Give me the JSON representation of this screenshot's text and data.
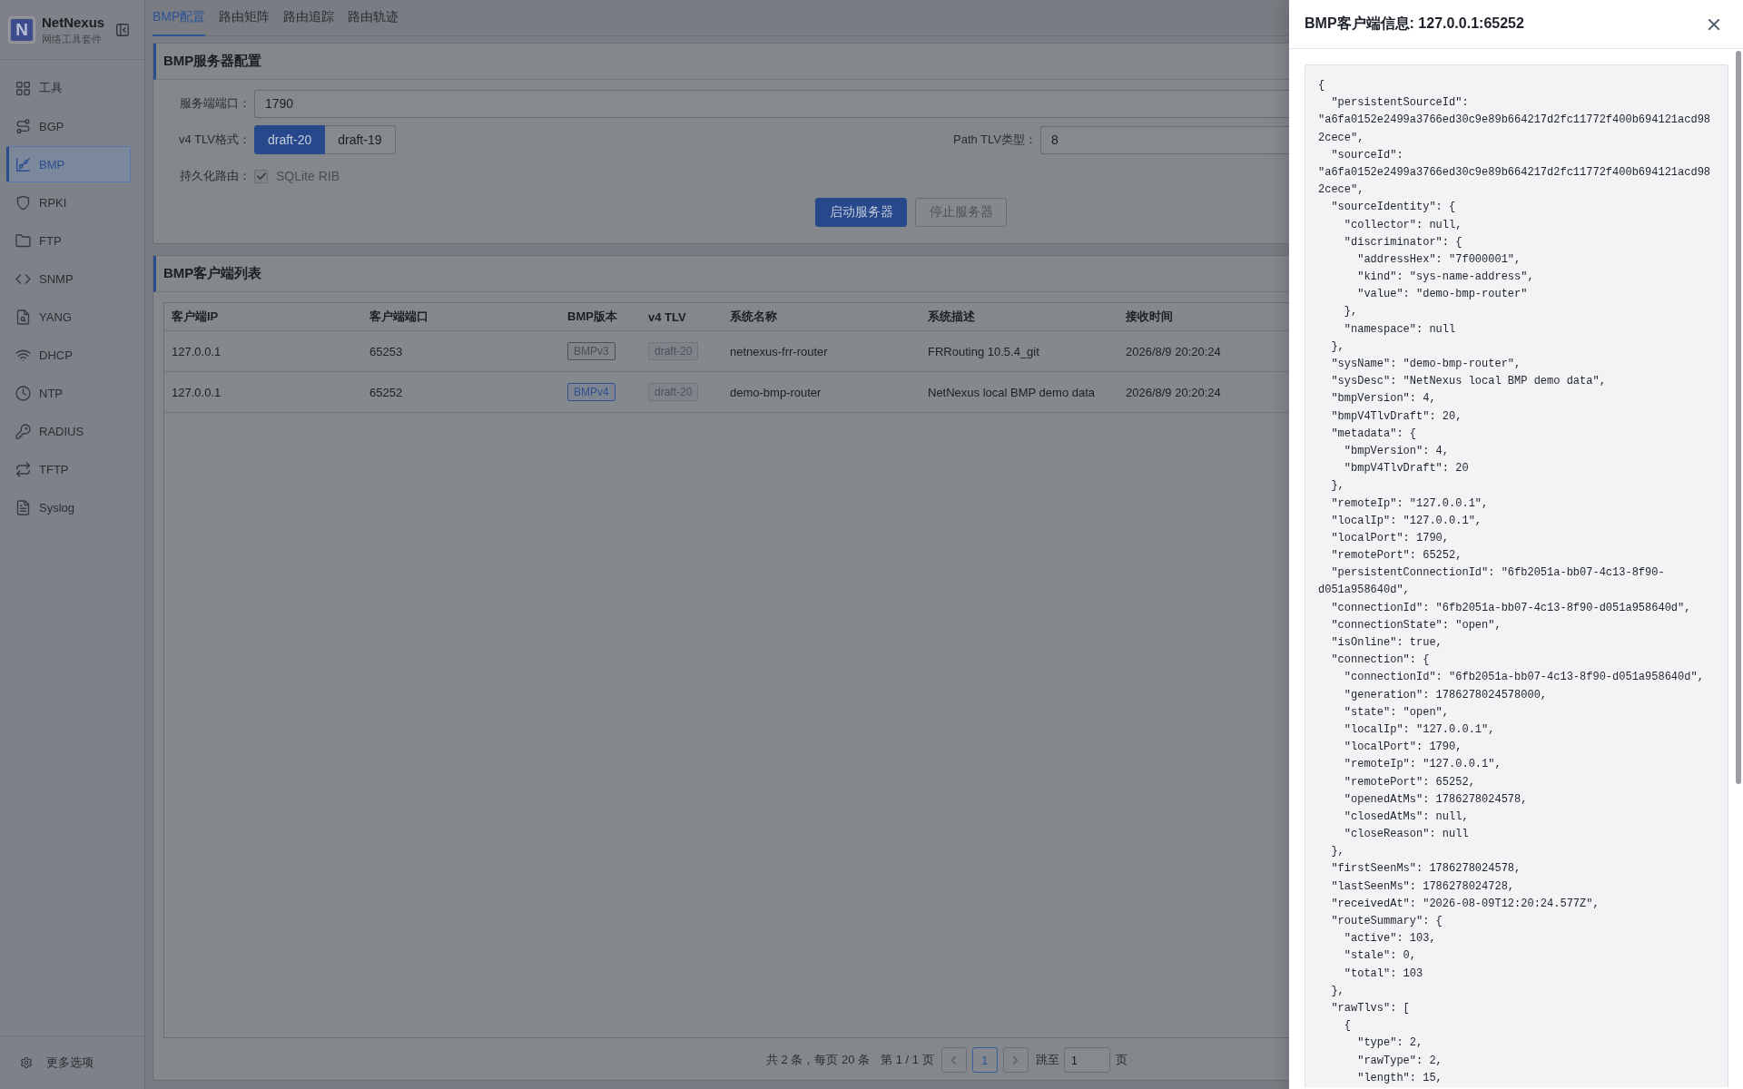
{
  "sidebar": {
    "brand": {
      "logo_mark": "N",
      "name": "NetNexus",
      "subtitle": "网络工具套件"
    },
    "items": [
      {
        "label": "工具",
        "selected": false
      },
      {
        "label": "BGP",
        "selected": false
      },
      {
        "label": "BMP",
        "selected": true
      },
      {
        "label": "RPKI",
        "selected": false
      },
      {
        "label": "FTP",
        "selected": false
      },
      {
        "label": "SNMP",
        "selected": false
      },
      {
        "label": "YANG",
        "selected": false
      },
      {
        "label": "DHCP",
        "selected": false
      },
      {
        "label": "NTP",
        "selected": false
      },
      {
        "label": "RADIUS",
        "selected": false
      },
      {
        "label": "TFTP",
        "selected": false
      },
      {
        "label": "Syslog",
        "selected": false
      }
    ],
    "footer": {
      "label": "更多选项"
    }
  },
  "tabs": [
    {
      "label": "BMP配置",
      "selected": true
    },
    {
      "label": "路由矩阵",
      "selected": false
    },
    {
      "label": "路由追踪",
      "selected": false
    },
    {
      "label": "路由轨迹",
      "selected": false
    }
  ],
  "server_config": {
    "title": "BMP服务器配置",
    "port": {
      "label": "服务端端口：",
      "value": "1790"
    },
    "tlv_format": {
      "label": "v4 TLV格式：",
      "options": [
        {
          "label": "draft-20",
          "selected": true
        },
        {
          "label": "draft-19",
          "selected": false
        }
      ]
    },
    "path_tlv_type": {
      "label": "Path TLV类型：",
      "value": "8"
    },
    "persistence": {
      "label": "持久化路由：",
      "option": {
        "label": "SQLite RIB",
        "checked": true,
        "disabled": true
      }
    },
    "buttons": [
      {
        "label": "启动服务器",
        "kind": "primary",
        "disabled": false
      },
      {
        "label": "停止服务器",
        "kind": "default",
        "disabled": true
      }
    ]
  },
  "client_list": {
    "title": "BMP客户端列表",
    "table": {
      "columns": [
        "客户端IP",
        "客户端端口",
        "BMP版本",
        "v4 TLV",
        "系统名称",
        "系统描述",
        "接收时间"
      ],
      "rows": [
        {
          "ip": "127.0.0.1",
          "port": "65253",
          "bmp_version": {
            "label": "BMPv3",
            "color": "#4d5156"
          },
          "tlv": "draft-20",
          "sys_name": "netnexus-frr-router",
          "sys_desc": "FRRouting 10.5.4_git",
          "received": "2026/8/9 20:20:24"
        },
        {
          "ip": "127.0.0.1",
          "port": "65252",
          "bmp_version": {
            "label": "BMPv4",
            "color": "#2f5291"
          },
          "tlv": "draft-20",
          "sys_name": "demo-bmp-router",
          "sys_desc": "NetNexus local BMP demo data",
          "received": "2026/8/9 20:20:24"
        }
      ]
    },
    "pagination": {
      "summary": "共 2 条，每页 20 条",
      "page_info": "第 1 / 1 页",
      "prev": {
        "disabled": true
      },
      "pages": [
        {
          "label": "1",
          "selected": true
        }
      ],
      "next": {
        "disabled": true
      },
      "jump_label": "跳至",
      "jump_value": "1",
      "jump_suffix": "页"
    }
  },
  "drawer": {
    "title": "BMP客户端信息: 127.0.0.1:65252",
    "code_lines": [
      "{",
      "  \"persistentSourceId\":",
      "\"a6fa0152e2499a3766ed30c9e89b664217d2fc11772f400b694121acd98",
      "2cece\",",
      "  \"sourceId\":",
      "\"a6fa0152e2499a3766ed30c9e89b664217d2fc11772f400b694121acd98",
      "2cece\",",
      "  \"sourceIdentity\": {",
      "    \"collector\": null,",
      "    \"discriminator\": {",
      "      \"addressHex\": \"7f000001\",",
      "      \"kind\": \"sys-name-address\",",
      "      \"value\": \"demo-bmp-router\"",
      "    },",
      "    \"namespace\": null",
      "  },",
      "  \"sysName\": \"demo-bmp-router\",",
      "  \"sysDesc\": \"NetNexus local BMP demo data\",",
      "  \"bmpVersion\": 4,",
      "  \"bmpV4TlvDraft\": 20,",
      "  \"metadata\": {",
      "    \"bmpVersion\": 4,",
      "    \"bmpV4TlvDraft\": 20",
      "  },",
      "  \"remoteIp\": \"127.0.0.1\",",
      "  \"localIp\": \"127.0.0.1\",",
      "  \"localPort\": 1790,",
      "  \"remotePort\": 65252,",
      "  \"persistentConnectionId\": \"6fb2051a-bb07-4c13-8f90-",
      "d051a958640d\",",
      "  \"connectionId\": \"6fb2051a-bb07-4c13-8f90-d051a958640d\",",
      "  \"connectionState\": \"open\",",
      "  \"isOnline\": true,",
      "  \"connection\": {",
      "    \"connectionId\": \"6fb2051a-bb07-4c13-8f90-d051a958640d\",",
      "    \"generation\": 1786278024578000,",
      "    \"state\": \"open\",",
      "    \"localIp\": \"127.0.0.1\",",
      "    \"localPort\": 1790,",
      "    \"remoteIp\": \"127.0.0.1\",",
      "    \"remotePort\": 65252,",
      "    \"openedAtMs\": 1786278024578,",
      "    \"closedAtMs\": null,",
      "    \"closeReason\": null",
      "  },",
      "  \"firstSeenMs\": 1786278024578,",
      "  \"lastSeenMs\": 1786278024728,",
      "  \"receivedAt\": \"2026-08-09T12:20:24.577Z\",",
      "  \"routeSummary\": {",
      "    \"active\": 103,",
      "    \"stale\": 0,",
      "    \"total\": 103",
      "  },",
      "  \"rawTlvs\": [",
      "    {",
      "      \"type\": 2,",
      "      \"rawType\": 2,",
      "      \"length\": 15,"
    ]
  }
}
